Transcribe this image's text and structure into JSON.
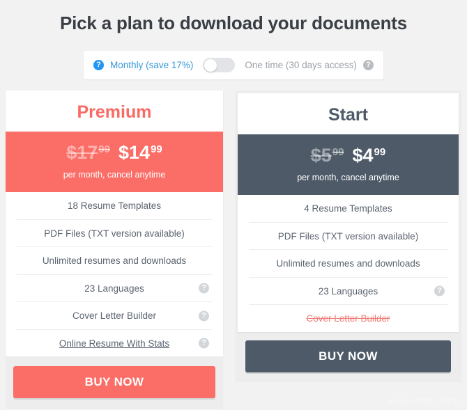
{
  "page": {
    "title": "Pick a plan to download your documents",
    "watermark": "www.ifam.com"
  },
  "billing_toggle": {
    "left_help_icon": "question-mark-icon",
    "left_label": "Monthly (save 17%)",
    "right_label": "One time (30 days access)",
    "right_help_icon": "question-mark-icon",
    "selected": "Monthly (save 17%)",
    "switch_state": "left",
    "active_color": "#3498db",
    "inactive_color": "#9aa0a6"
  },
  "plans": [
    {
      "name": "Premium",
      "accent_color": "#fb6d67",
      "old_price_dollars": "$17",
      "old_price_cents": "99",
      "new_price_dollars": "$14",
      "new_price_cents": "99",
      "price_note": "per month, cancel anytime",
      "features": [
        {
          "text": "18 Resume Templates",
          "help": false,
          "style": "normal"
        },
        {
          "text": "PDF Files (TXT version available)",
          "help": false,
          "style": "normal"
        },
        {
          "text": "Unlimited resumes and downloads",
          "help": false,
          "style": "normal"
        },
        {
          "text": "23 Languages",
          "help": true,
          "style": "normal"
        },
        {
          "text": "Cover Letter Builder",
          "help": true,
          "style": "normal"
        },
        {
          "text": "Online Resume With Stats",
          "help": true,
          "style": "underlined"
        }
      ],
      "buy_label": "BUY NOW"
    },
    {
      "name": "Start",
      "accent_color": "#4e5a68",
      "old_price_dollars": "$5",
      "old_price_cents": "99",
      "new_price_dollars": "$4",
      "new_price_cents": "99",
      "price_note": "per month, cancel anytime",
      "features": [
        {
          "text": "4 Resume Templates",
          "help": false,
          "style": "normal"
        },
        {
          "text": "PDF Files (TXT version available)",
          "help": false,
          "style": "normal"
        },
        {
          "text": "Unlimited resumes and downloads",
          "help": false,
          "style": "normal"
        },
        {
          "text": "23 Languages",
          "help": true,
          "style": "normal"
        },
        {
          "text": "Cover Letter Builder",
          "help": false,
          "style": "struck"
        }
      ],
      "buy_label": "BUY NOW"
    }
  ],
  "icons": {
    "help_glyph": "?"
  }
}
